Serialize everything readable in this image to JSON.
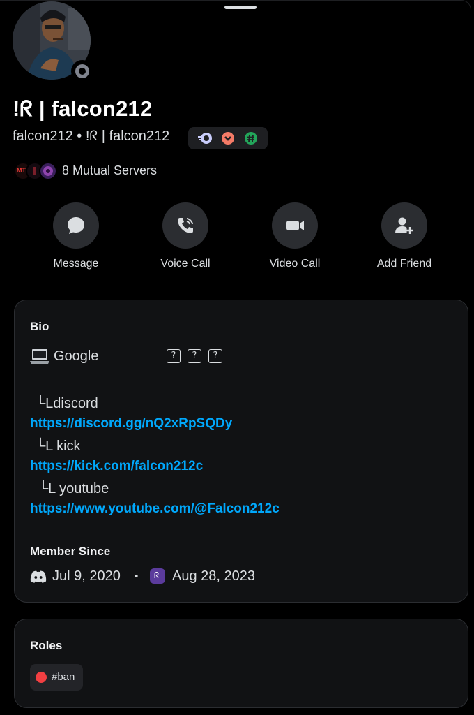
{
  "profile": {
    "display_name": "!ᖇ | falcon212",
    "username_line": "falcon212 • !ᖇ | falcon212",
    "mutual_servers": "8 Mutual Servers",
    "mutual_server_icon_text": "MT"
  },
  "actions": [
    {
      "label": "Message",
      "icon": "chat-bubble-icon"
    },
    {
      "label": "Voice Call",
      "icon": "phone-icon"
    },
    {
      "label": "Video Call",
      "icon": "video-camera-icon"
    },
    {
      "label": "Add Friend",
      "icon": "add-friend-icon"
    }
  ],
  "bio": {
    "heading": "Bio",
    "line1": "Google",
    "boxes": [
      "?",
      "?",
      "?"
    ],
    "discord_label": "└Ldiscord",
    "discord_link": "https://discord.gg/nQ2xRpSQDy",
    "kick_label": "└L  kick",
    "kick_link": "https://kick.com/falcon212c",
    "youtube_label": "└L youtube",
    "youtube_link": "https://www.youtube.com/@Falcon212c"
  },
  "member_since": {
    "heading": "Member Since",
    "discord_date": "Jul 9, 2020",
    "separator": "•",
    "server_date": "Aug 28, 2023",
    "server_icon_text": "ᖇ"
  },
  "roles": {
    "heading": "Roles",
    "items": [
      {
        "name": "#ban",
        "color": "#f23f42"
      }
    ]
  },
  "colors": {
    "background": "#000000",
    "card": "#111214",
    "action_button": "#2b2d31",
    "link": "#00a8fc",
    "status_idle": "#80848e",
    "badge_speed": "#5865f2",
    "badge_heart": "#f47b67",
    "badge_hash": "#23a55a"
  }
}
